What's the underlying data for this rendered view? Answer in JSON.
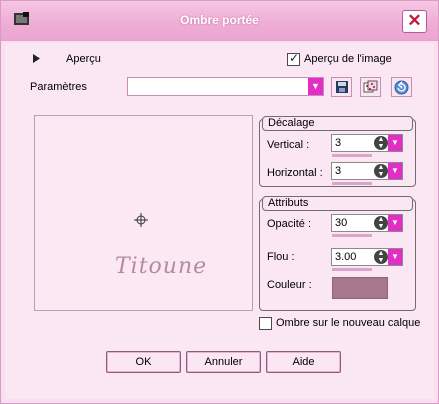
{
  "window": {
    "title": "Ombre portée",
    "close_glyph": "✕"
  },
  "top_bar": {
    "preview_toggle_label": "Aperçu",
    "preview_image_checkbox_label": "Aperçu de l'image",
    "preview_image_checked": true
  },
  "params": {
    "label": "Paramètres",
    "preset_value": ""
  },
  "preview": {
    "watermark_text": "Titoune"
  },
  "offset": {
    "title": "Décalage",
    "vertical_label": "Vertical :",
    "vertical_value": "3",
    "horizontal_label": "Horizontal :",
    "horizontal_value": "3"
  },
  "attributes": {
    "title": "Attributs",
    "opacity_label": "Opacité :",
    "opacity_value": "30",
    "blur_label": "Flou :",
    "blur_value": "3.00",
    "color_label": "Couleur :",
    "color_value": "#a97890"
  },
  "new_layer": {
    "label": "Ombre sur le nouveau calque",
    "checked": false
  },
  "buttons": {
    "ok": "OK",
    "cancel": "Annuler",
    "help": "Aide"
  },
  "colors": {
    "accent": "#e22dc6",
    "background": "#fbe6f3"
  }
}
